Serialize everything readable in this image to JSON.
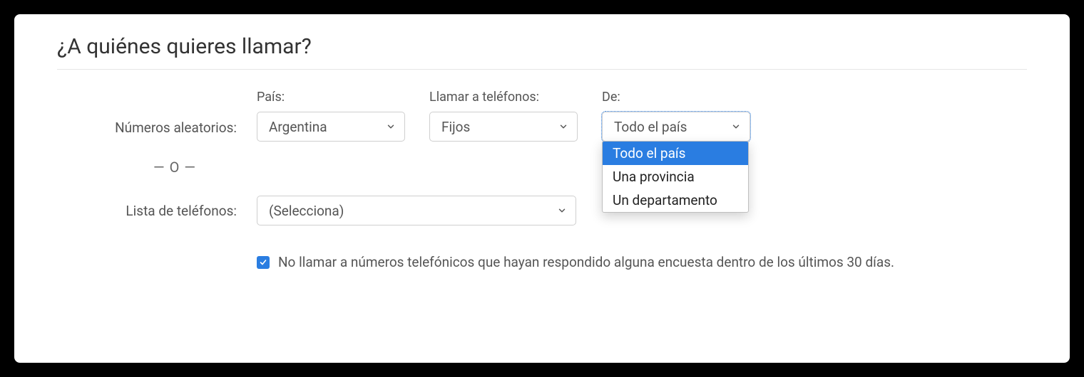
{
  "heading": "¿A quiénes quieres llamar?",
  "random_row": {
    "label": "Números aleatorios:",
    "country": {
      "label": "País:",
      "value": "Argentina"
    },
    "call_to": {
      "label": "Llamar a teléfonos:",
      "value": "Fijos"
    },
    "scope": {
      "label": "De:",
      "value": "Todo el país",
      "options": [
        "Todo el país",
        "Una provincia",
        "Un departamento"
      ]
    }
  },
  "or_text": "— O —",
  "list_row": {
    "label": "Lista de teléfonos:",
    "value": "(Selecciona)"
  },
  "checkbox": {
    "checked": true,
    "label": "No llamar a números telefónicos que hayan respondido alguna encuesta dentro de los últimos 30 días."
  }
}
